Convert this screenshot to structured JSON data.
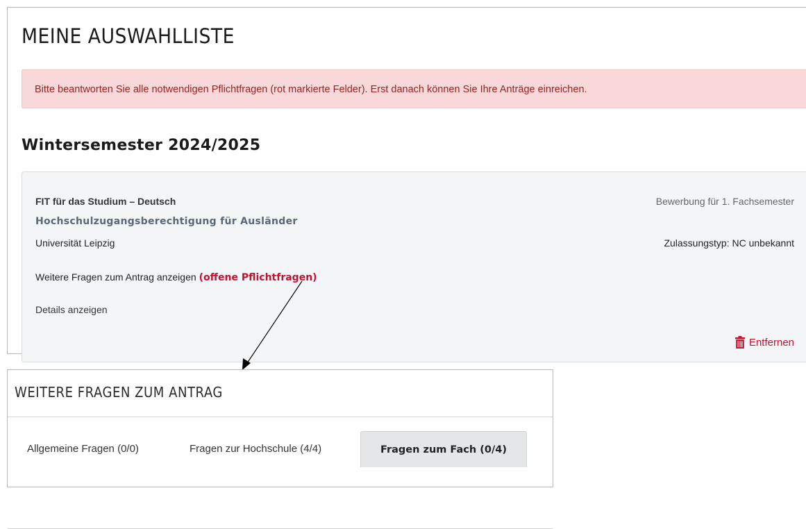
{
  "page": {
    "title": "MEINE AUSWAHLLISTE",
    "alert_text": "Bitte beantworten Sie alle notwendigen Pflichtfragen (rot markierte Felder). Erst danach können Sie Ihre Anträge einreichen.",
    "semester_heading": "Wintersemester 2024/2025"
  },
  "application": {
    "course": "FIT für das Studium – Deutsch",
    "qualification": "Hochschulzugangsberechtigung für Ausländer",
    "university": "Universität Leipzig",
    "application_type": "Bewerbung für 1. Fachsemester",
    "admission_type": "Zulassungstyp: NC unbekannt",
    "more_questions_link": "Weitere Fragen zum Antrag anzeigen",
    "open_questions_badge": "(offene Pflichtfragen)",
    "details_link": "Details anzeigen",
    "remove_label": "Entfernen",
    "accent_color": "#c8102e"
  },
  "questions_panel": {
    "title": "WEITERE FRAGEN ZUM ANTRAG",
    "tabs": [
      {
        "label": "Allgemeine Fragen (0/0)",
        "active": false
      },
      {
        "label": "Fragen zur Hochschule (4/4)",
        "active": false
      },
      {
        "label": "Fragen zum Fach (0/4)",
        "active": true
      }
    ]
  }
}
